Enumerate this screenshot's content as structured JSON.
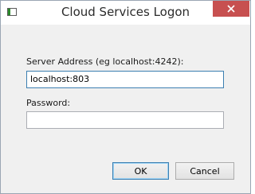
{
  "window": {
    "title": "Cloud Services Logon"
  },
  "form": {
    "server_label": "Server Address (eg localhost:4242):",
    "server_value": "localhost:803",
    "password_label": "Password:",
    "password_value": ""
  },
  "buttons": {
    "ok_label": "OK",
    "cancel_label": "Cancel"
  },
  "colors": {
    "close_button": "#c75050",
    "focus_border": "#3c7fb1"
  },
  "icons": {
    "app": "window-app-icon",
    "close": "close-icon"
  }
}
